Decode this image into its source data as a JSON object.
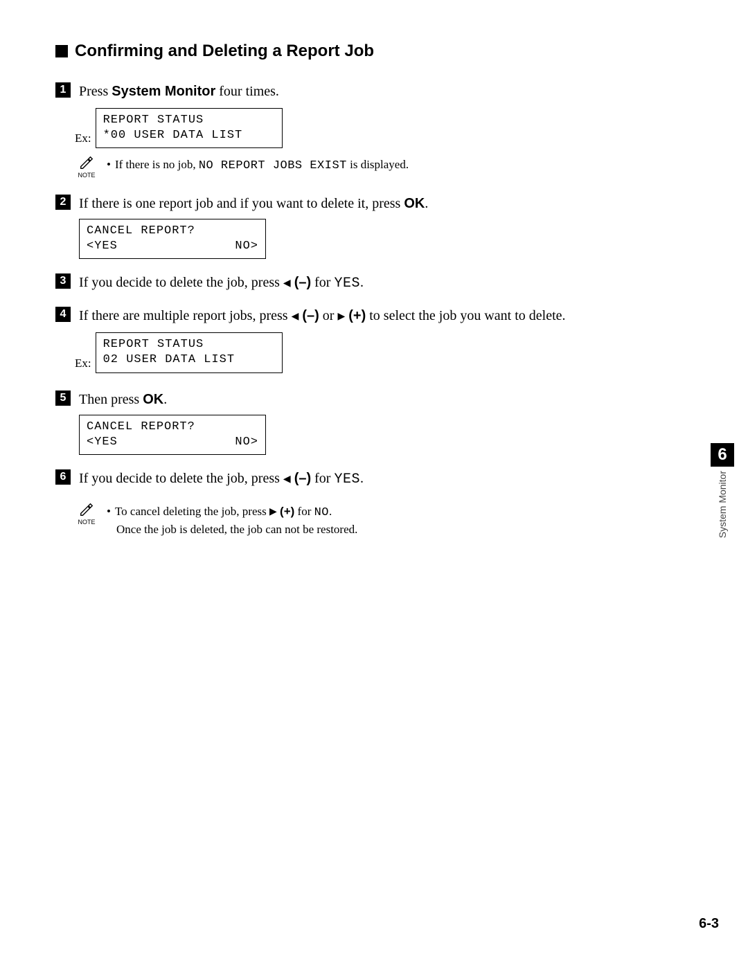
{
  "heading": "Confirming and Deleting a Report Job",
  "steps": {
    "1": {
      "pre": "Press ",
      "button": "System Monitor",
      "post": " four times."
    },
    "2": {
      "pre": "If there is one report job and if you want to delete it, press ",
      "button": "OK",
      "post": "."
    },
    "3": {
      "pre": "If you decide to delete the job, press ",
      "minus": "(–)",
      "for": " for ",
      "yes": "YES",
      "post": "."
    },
    "4": {
      "pre": "If there are multiple report jobs, press ",
      "minus": "(–)",
      "or": " or ",
      "plus": "(+)",
      "post": " to select the job you want to delete."
    },
    "5": {
      "pre": "Then press ",
      "button": "OK",
      "post": "."
    },
    "6": {
      "pre": "If you decide to delete the job, press ",
      "minus": "(–)",
      "for": " for ",
      "yes": "YES",
      "post": "."
    }
  },
  "ex_label": "Ex:",
  "lcd": {
    "a": {
      "l1": "REPORT STATUS",
      "l2": "*00 USER DATA LIST"
    },
    "b": {
      "l1": "CANCEL REPORT?",
      "l2a": " <YES",
      "l2b": "NO> "
    },
    "c": {
      "l1": "REPORT STATUS",
      "l2": "02 USER DATA LIST"
    },
    "d": {
      "l1": "CANCEL REPORT?",
      "l2a": " <YES",
      "l2b": "NO> "
    }
  },
  "note_label": "NOTE",
  "notes": {
    "n1": {
      "pre": "If there is no job, ",
      "mono": "NO REPORT JOBS EXIST",
      "post": " is displayed."
    },
    "n2": {
      "pre": "To cancel deleting the job, press ",
      "plus": "(+)",
      "for": " for ",
      "no": "NO",
      "post": ".",
      "line2": "Once the job is deleted, the job can not be restored."
    }
  },
  "tab": {
    "num": "6",
    "label": "System Monitor"
  },
  "page_number": "6-3"
}
